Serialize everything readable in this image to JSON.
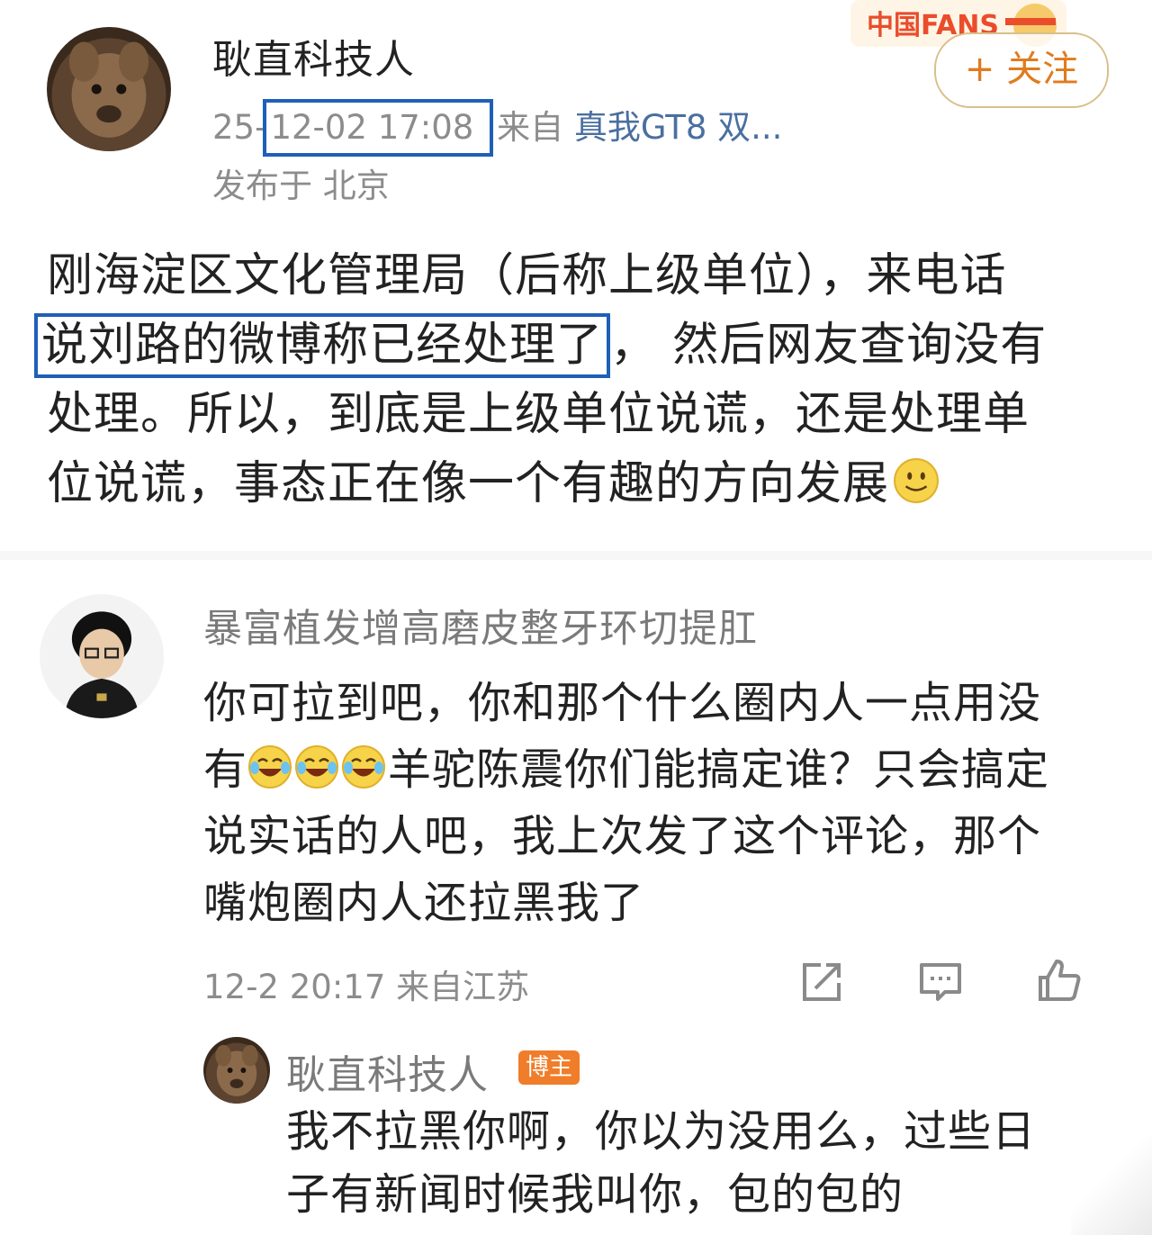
{
  "post": {
    "author": "耿直科技人",
    "time_prefix": "25-",
    "time": "12-02 17:08",
    "source_label": "来自",
    "device": "真我GT8 双...",
    "location": "发布于 北京",
    "follow_label": "+ 关注",
    "badge_text": "中国FANS",
    "body_lines": [
      "刚海淀区文化管理局（后称上级单位），来电话",
      "然后网友查询没有",
      "处理。所以，到底是上级单位说谎，还是处理单",
      "位说谎，事态正在像一个有趣的方向发展"
    ],
    "highlight": "说刘路的微博称已经处理了",
    "highlight_tail": "，"
  },
  "comment": {
    "author": "暴富植发增高磨皮整牙环切提肛",
    "lines": [
      "你可拉到吧，你和那个什么圈内人一点用没",
      "羊驼陈震你们能搞定谁？只会搞定",
      "说实话的人吧，我上次发了这个评论，那个",
      "嘴炮圈内人还拉黑我了"
    ],
    "line2_prefix": "有",
    "meta": "12-2 20:17 来自江苏"
  },
  "reply": {
    "author": "耿直科技人",
    "badge": "博主",
    "lines": [
      "我不拉黑你啊，你以为没用么，过些日",
      "子有新闻时候我叫你，包的包的"
    ]
  },
  "icons": {
    "share": "share-icon",
    "comment": "comment-icon",
    "like": "thumbs-up-icon",
    "smile": "smile-emoji-icon",
    "laugh": "laugh-cry-emoji-icon"
  },
  "colors": {
    "highlight_box": "#1f5fb8",
    "follow_text": "#e07b1e",
    "badge_bg": "#f07d2a",
    "meta_gray": "#8c8c8c"
  }
}
